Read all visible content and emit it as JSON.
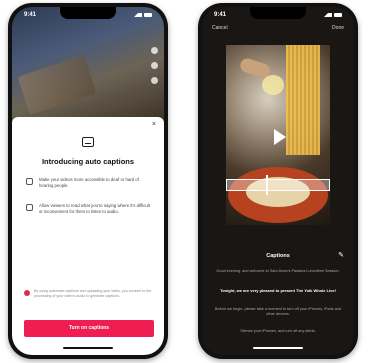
{
  "status_time": "9:41",
  "left_phone": {
    "sheet_title": "Introducing auto captions",
    "close_label": "×",
    "bullets": [
      "Make your videos more accessible to deaf or hard of hearing people.",
      "Allow viewers to read what you're saying where it's difficult or inconvenient for them to listen to audio."
    ],
    "consent_text": "By using automatic captions and uploading your video, you consent to the processing of your video's audio to generate captions.",
    "turn_on_button": "Turn on captions"
  },
  "right_phone": {
    "cancel_label": "Cancel",
    "done_label": "Done",
    "captions_title": "Captions",
    "caption_lines": [
      "Good evening, and welcome to Sam Dean's Pastaria Lunchtime Session.",
      "Tonight, we are very pleased to present The Yolk Whole Live!",
      "Before we begin, please take a moment to turn off your iPhones, iPads and other devices.",
      "Silence your iPhones, and turn off any alerts."
    ]
  },
  "colors": {
    "accent": "#ee1d52",
    "right_bg": "#1a1613"
  },
  "icons": [
    "close-icon",
    "captions-icon",
    "info-icon",
    "edit-icon",
    "play-icon"
  ]
}
